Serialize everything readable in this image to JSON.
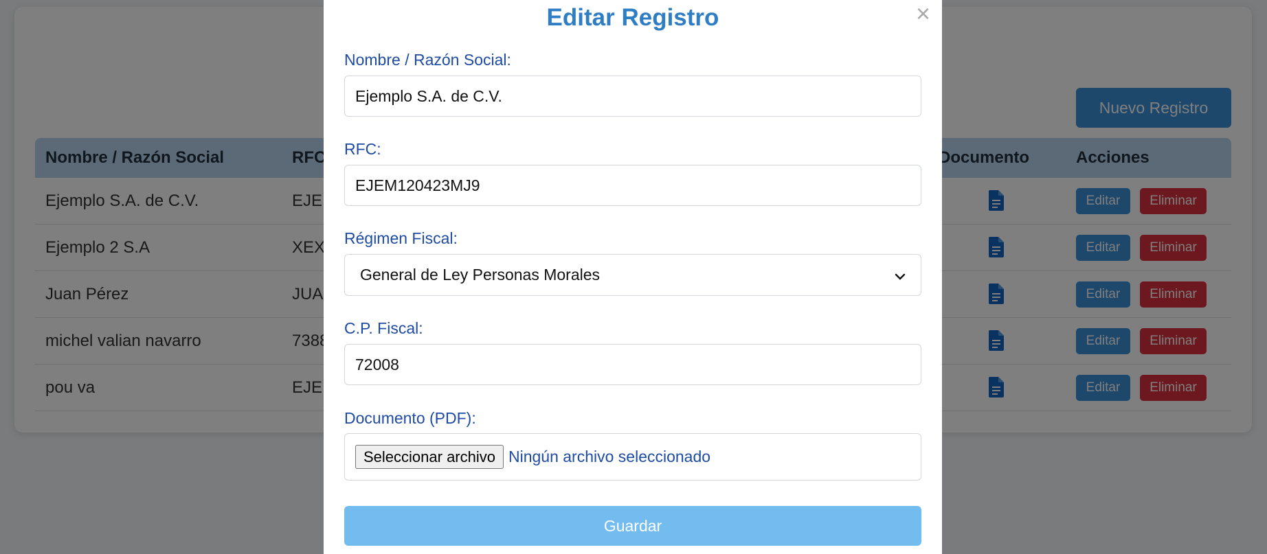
{
  "background": {
    "new_button_label": "Nuevo Registro",
    "table": {
      "headers": {
        "name": "Nombre / Razón Social",
        "rfc": "RFC",
        "document": "Documento",
        "actions": "Acciones"
      },
      "rows": [
        {
          "name": "Ejemplo S.A. de C.V.",
          "rfc": "EJE"
        },
        {
          "name": "Ejemplo 2 S.A",
          "rfc": "XEX"
        },
        {
          "name": "Juan Pérez",
          "rfc": "JUA"
        },
        {
          "name": "michel valian navarro",
          "rfc": "7388"
        },
        {
          "name": "pou va",
          "rfc": "EJE"
        }
      ],
      "edit_label": "Editar",
      "delete_label": "Eliminar",
      "document_icon": "document-icon"
    }
  },
  "modal": {
    "title": "Editar Registro",
    "close_symbol": "×",
    "fields": {
      "name_label": "Nombre / Razón Social:",
      "name_value": "Ejemplo S.A. de C.V.",
      "rfc_label": "RFC:",
      "rfc_value": "EJEM120423MJ9",
      "regimen_label": "Régimen Fiscal:",
      "regimen_value": "General de Ley Personas Morales",
      "cp_label": "C.P. Fiscal:",
      "cp_value": "72008",
      "document_label": "Documento (PDF):",
      "file_button_label": "Seleccionar archivo",
      "file_status": "Ningún archivo seleccionado"
    },
    "save_label": "Guardar"
  },
  "colors": {
    "title": "#2f7ec4",
    "label": "#1e4ba3",
    "primary": "#3a8fd6",
    "danger": "#d9313c",
    "save": "#72bcf0"
  }
}
